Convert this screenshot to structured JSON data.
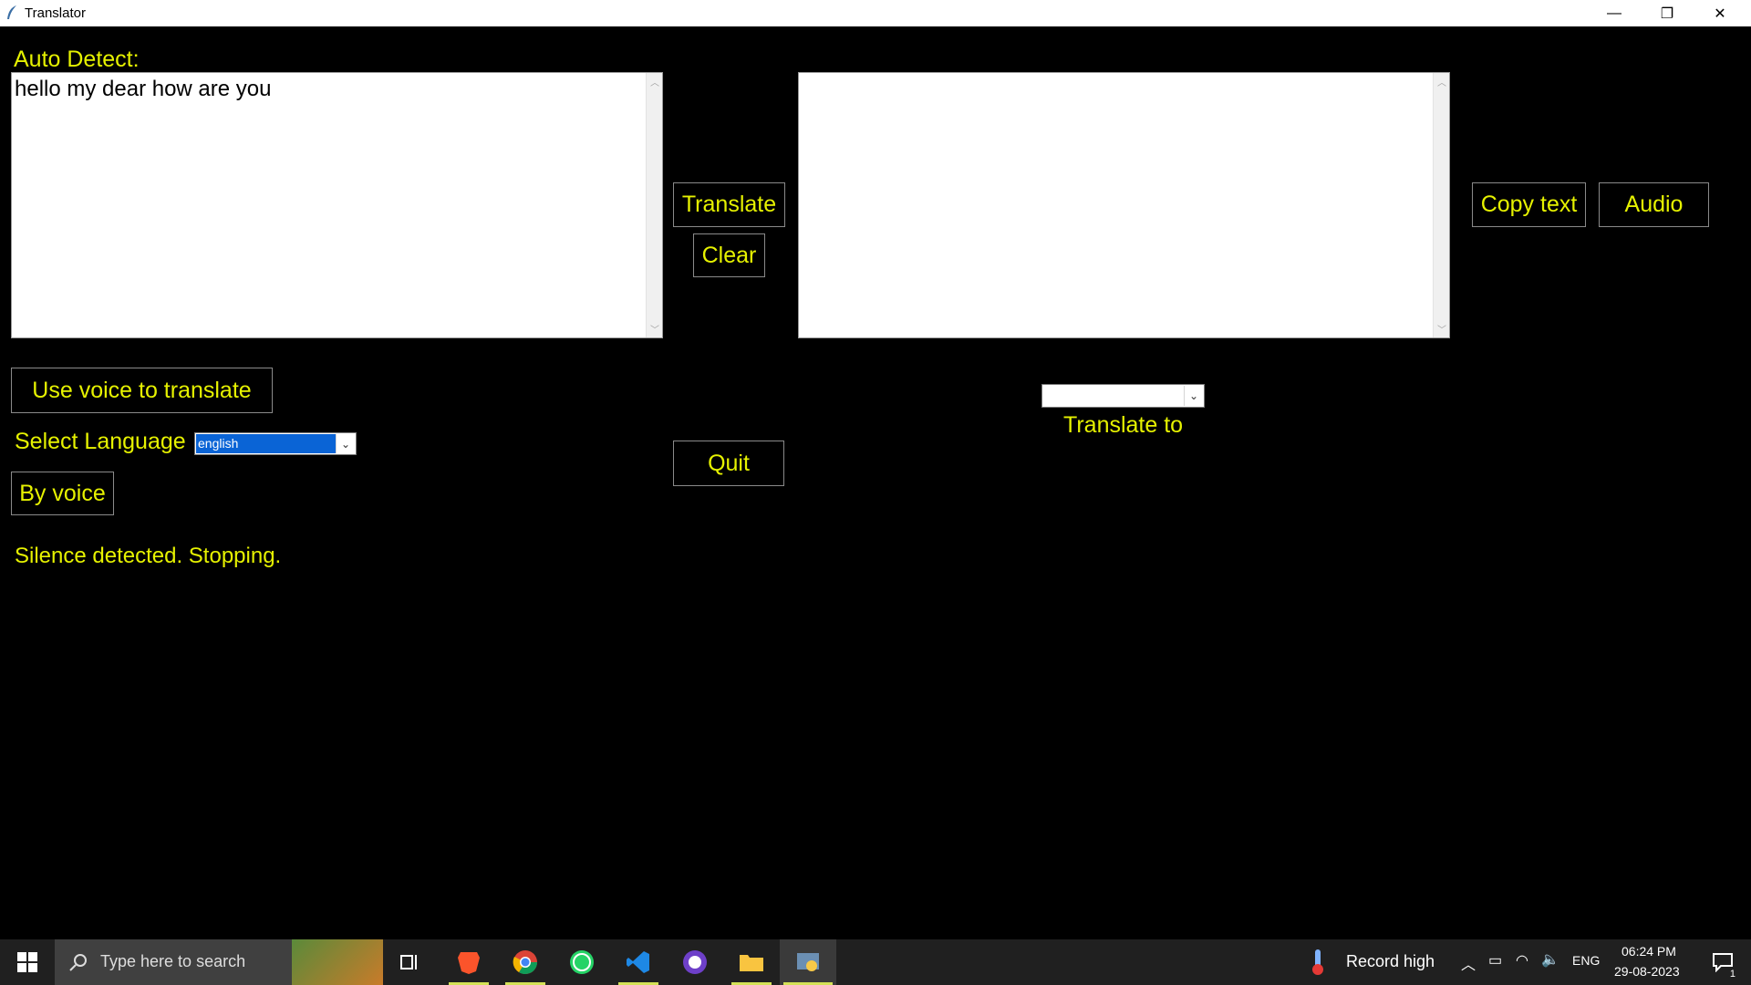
{
  "window": {
    "title": "Translator",
    "minimize": "—",
    "maximize": "❐",
    "close": "✕"
  },
  "source": {
    "label": "Auto Detect:",
    "text": "hello my dear how are you"
  },
  "buttons": {
    "translate": "Translate",
    "clear": "Clear",
    "copy_text": "Copy text",
    "audio": "Audio",
    "use_voice": "Use voice to translate",
    "by_voice": "By voice",
    "quit": "Quit"
  },
  "language": {
    "label": "Select Language",
    "selected": "english"
  },
  "target": {
    "text": "",
    "selected": "",
    "label": "Translate to"
  },
  "status": "Silence detected. Stopping.",
  "taskbar": {
    "search_placeholder": "Type here to search",
    "weather": "Record high",
    "lang": "ENG",
    "time": "06:24 PM",
    "date": "29-08-2023",
    "notification_count": "1",
    "apps": [
      "task-view",
      "brave",
      "chrome",
      "whatsapp",
      "vscode",
      "github-desktop",
      "file-explorer",
      "python"
    ]
  },
  "colors": {
    "accent": "#e6f200",
    "background": "#000000"
  }
}
